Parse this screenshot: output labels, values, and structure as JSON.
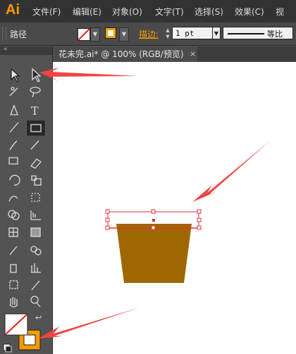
{
  "app": {
    "logo": "Ai"
  },
  "menu": [
    "文件(F)",
    "编辑(E)",
    "对象(O)",
    "文字(T)",
    "选择(S)",
    "效果(C)",
    "视"
  ],
  "control_bar": {
    "selection_label": "路径",
    "stroke_label": "描边:",
    "stroke_weight": "1 pt",
    "stroke_profile": "等比"
  },
  "document": {
    "tab_title": "花未完.ai* @ 100% (RGB/预览)",
    "close": "×"
  },
  "colors": {
    "stroke_swatch": "#f5a300",
    "pot_fill": "#9e6700",
    "selection": "#e0303a",
    "arrow": "#f14444"
  },
  "fill_stroke": {
    "swap_symbol": "↩"
  }
}
